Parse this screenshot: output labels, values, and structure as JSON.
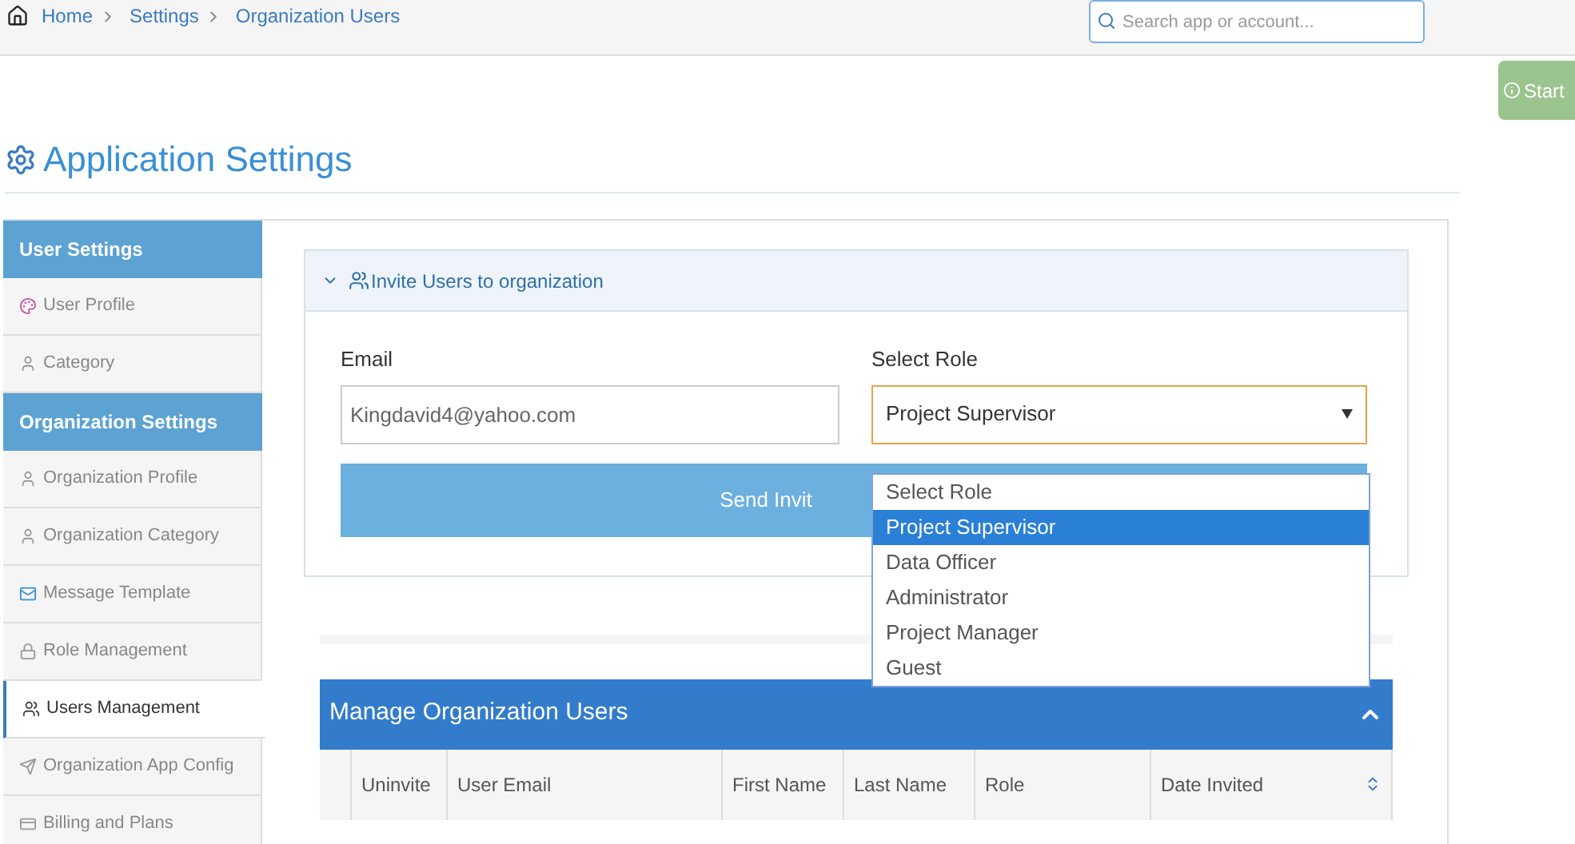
{
  "breadcrumb": [
    "Home",
    "Settings",
    "Organization Users"
  ],
  "search": {
    "placeholder": "Search app or account..."
  },
  "start_button": "Start",
  "page_title": "Application Settings",
  "sidebar": [
    {
      "kind": "header",
      "label": "User Settings",
      "selected": false
    },
    {
      "kind": "item",
      "label": "User Profile",
      "selected": false
    },
    {
      "kind": "item",
      "label": "Category",
      "selected": false
    },
    {
      "kind": "header",
      "label": "Organization Settings",
      "selected": false
    },
    {
      "kind": "item",
      "label": "Organization Profile",
      "selected": false
    },
    {
      "kind": "item",
      "label": "Organization Category",
      "selected": false
    },
    {
      "kind": "item",
      "label": "Message Template",
      "selected": false
    },
    {
      "kind": "item",
      "label": "Role Management",
      "selected": false
    },
    {
      "kind": "item",
      "label": "Users Management",
      "selected": true
    },
    {
      "kind": "item",
      "label": "Organization App Config",
      "selected": false
    },
    {
      "kind": "item",
      "label": "Billing and Plans",
      "selected": false
    }
  ],
  "invite_panel": {
    "title": "Invite Users to organization",
    "expanded": true,
    "email_label": "Email",
    "email_value": "Kingdavid4@yahoo.com",
    "role_label": "Select Role",
    "role_value": "Project Supervisor",
    "send_button": "Send Invit",
    "role_options": [
      {
        "label": "Select Role",
        "selected": false
      },
      {
        "label": "Project Supervisor",
        "selected": true
      },
      {
        "label": "Data Officer",
        "selected": false
      },
      {
        "label": "Administrator",
        "selected": false
      },
      {
        "label": "Project Manager",
        "selected": false
      },
      {
        "label": "Guest",
        "selected": false
      }
    ]
  },
  "users_table": {
    "title": "Manage Organization Users",
    "columns": [
      "Uninvite",
      "User Email",
      "First Name",
      "Last Name",
      "Role",
      "Date Invited"
    ]
  }
}
